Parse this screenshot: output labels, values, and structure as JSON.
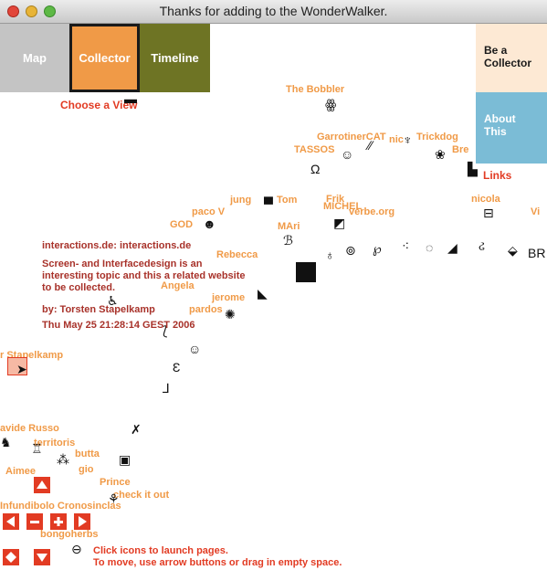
{
  "window": {
    "title": "Thanks for adding to the WonderWalker."
  },
  "nav": {
    "map": "Map",
    "collector": "Collector",
    "timeline": "Timeline",
    "choose_view": "Choose a View"
  },
  "side": {
    "be_collector": "Be a Collector",
    "about": "About This",
    "links": "Links"
  },
  "collectors": [
    "The Bobbler",
    "GarrotinerCAT",
    "nic",
    "Trickdog",
    "TASSOS",
    "Bre",
    "jung",
    "Tom",
    "Frik",
    "MICHEL",
    "verbe.org",
    "nicola",
    "Vi",
    "paco V",
    "GOD",
    "MAri",
    "Rebecca",
    "Angela",
    "jerome",
    "pardos",
    "r Stapelkamp",
    "avide Russo",
    "territoris",
    "butta",
    "gio",
    "Aimee",
    "Prince",
    "check it out",
    "Infundibolo Cronosinclas",
    "bongoherbs"
  ],
  "detail": {
    "title": "interactions.de: interactions.de",
    "description": "Screen- and Interfacedesign is an interesting topic and this a related website to be collected.",
    "author": "by: Torsten Stapelkamp",
    "date": "Thu May 25 21:28:14 GEST 2006"
  },
  "hint": {
    "line1": "Click icons to launch pages.",
    "line2": "To move, use arrow buttons or drag in empty space."
  },
  "colors": {
    "accent": "#e23b23",
    "label": "#f09a47",
    "detail": "#a8322a",
    "timeline": "#6e7424",
    "about": "#7bbcd6"
  }
}
